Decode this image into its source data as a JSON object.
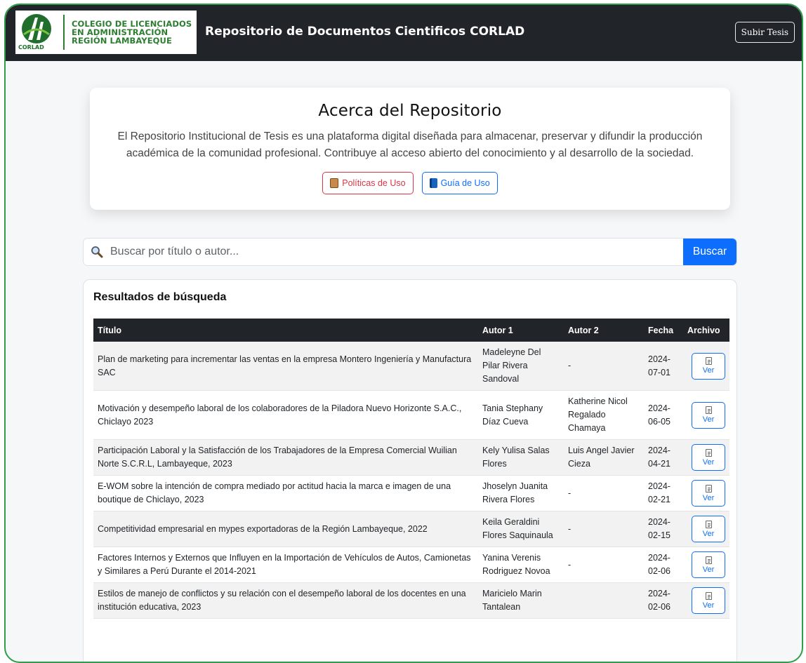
{
  "logo": {
    "line1": "COLEGIO DE LICENCIADOS",
    "line2": "EN ADMINISTRACIÓN",
    "line3": "REGIÓN LAMBAYEQUE",
    "mark_label": "CORLAD"
  },
  "navbar": {
    "title": "Repositorio de Documentos Cientificos CORLAD",
    "subir_label": "Subir Tesis"
  },
  "about": {
    "title": "Acerca del Repositorio",
    "text": "El Repositorio Institucional de Tesis es una plataforma digital diseñada para almacenar, preservar y difundir la producción académica de la comunidad profesional. Contribuye al acceso abierto del conocimiento y al desarrollo de la sociedad.",
    "politicas_label": "Políticas de Uso",
    "guia_label": "Guía de Uso"
  },
  "search": {
    "placeholder": "Buscar por título o autor...",
    "button_label": "Buscar",
    "icon": "search-icon"
  },
  "results": {
    "title": "Resultados de búsqueda",
    "columns": [
      "Título",
      "Autor 1",
      "Autor 2",
      "Fecha",
      "Archivo"
    ],
    "ver_label": "Ver",
    "rows": [
      {
        "titulo": "Plan de marketing para incrementar las ventas en la empresa Montero Ingeniería y Manufactura SAC",
        "autor1": "Madeleyne Del Pilar Rivera Sandoval",
        "autor2": "-",
        "fecha": "2024-07-01"
      },
      {
        "titulo": "Motivación y desempeño laboral de los colaboradores de la Piladora Nuevo Horizonte S.A.C., Chiclayo 2023",
        "autor1": "Tania Stephany Díaz Cueva",
        "autor2": "Katherine Nicol Regalado Chamaya",
        "fecha": "2024-06-05"
      },
      {
        "titulo": "Participación Laboral y la Satisfacción de los Trabajadores de la Empresa Comercial Wuilian Norte S.C.R.L, Lambayeque, 2023",
        "autor1": "Kely Yulisa Salas Flores",
        "autor2": "Luis Angel Javier Cieza",
        "fecha": "2024-04-21"
      },
      {
        "titulo": "E-WOM sobre la intención de compra mediado por actitud hacia la marca e imagen de una boutique de Chiclayo, 2023",
        "autor1": "Jhoselyn Juanita Rivera Flores",
        "autor2": "-",
        "fecha": "2024-02-21"
      },
      {
        "titulo": "Competitividad empresarial en mypes exportadoras de la Región Lambayeque, 2022",
        "autor1": "Keila Geraldini Flores Saquinaula",
        "autor2": "-",
        "fecha": "2024-02-15"
      },
      {
        "titulo": "Factores Internos y Externos que Influyen en la Importación de Vehículos de Autos, Camionetas y Similares a Perú Durante el 2014-2021",
        "autor1": "Yanina Verenis Rodriguez Novoa",
        "autor2": "-",
        "fecha": "2024-02-06"
      },
      {
        "titulo": "Estilos de manejo de conflictos y su relación con el desempeño laboral de los docentes en una institución educativa, 2023",
        "autor1": "Maricielo Marin Tantalean",
        "autor2": "",
        "fecha": "2024-02-06"
      }
    ]
  },
  "colors": {
    "frame_border": "#2e9e4a",
    "navbar_bg": "#212529",
    "primary": "#0d6efd",
    "danger": "#dc3545",
    "logo_green": "#2e7d32"
  }
}
